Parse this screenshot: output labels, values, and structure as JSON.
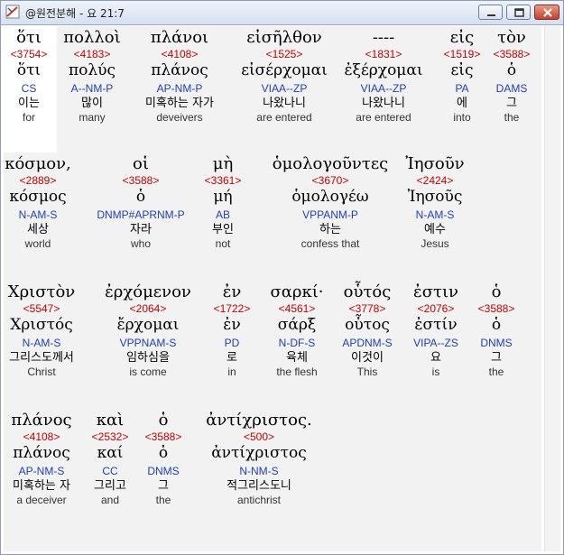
{
  "window": {
    "title": "@원전분해 - 요 21:7",
    "icon": "app-logo-icon"
  },
  "rows": [
    [
      {
        "greek": "ὅτι",
        "strong": "<3754>",
        "lemma": "ὅτι",
        "parse": "CS",
        "korean": "이는",
        "english": "for"
      },
      {
        "greek": "πολλοὶ",
        "strong": "<4183>",
        "lemma": "πολύς",
        "parse": "A--NM-P",
        "korean": "많이",
        "english": "many"
      },
      {
        "greek": "πλάνοι",
        "strong": "<4108>",
        "lemma": "πλάνος",
        "parse": "AP-NM-P",
        "korean": "미혹하는 자가",
        "english": "deveivers"
      },
      {
        "greek": "εἰσῆλθον",
        "strong": "<1525>",
        "lemma": "εἰσέρχομαι",
        "parse": "VIAA--ZP",
        "korean": "나왔나니",
        "english": "are entered"
      },
      {
        "greek": "----",
        "strong": "<1831>",
        "lemma": "ἐξέρχομαι",
        "parse": "VIAA--ZP",
        "korean": "나왔나니",
        "english": "are entered"
      },
      {
        "greek": "εἰς",
        "strong": "<1519>",
        "lemma": "εἰς",
        "parse": "PA",
        "korean": "에",
        "english": "into"
      },
      {
        "greek": "τὸν",
        "strong": "<3588>",
        "lemma": "ὁ",
        "parse": "DAMS",
        "korean": "그",
        "english": "the"
      }
    ],
    [
      {
        "greek": "κόσμον,",
        "strong": "<2889>",
        "lemma": "κόσμος",
        "parse": "N-AM-S",
        "korean": "세상",
        "english": "world"
      },
      {
        "greek": "οἱ",
        "strong": "<3588>",
        "lemma": "ὁ",
        "parse": "DNMP#APRNM-P",
        "korean": "자라",
        "english": "who"
      },
      {
        "greek": "μὴ",
        "strong": "<3361>",
        "lemma": "μή",
        "parse": "AB",
        "korean": "부인",
        "english": "not"
      },
      {
        "greek": "ὁμολογοῦντες",
        "strong": "<3670>",
        "lemma": "ὁμολογέω",
        "parse": "VPPANM-P",
        "korean": "하는",
        "english": "confess that"
      },
      {
        "greek": "Ἰησοῦν",
        "strong": "<2424>",
        "lemma": "Ἰησοῦς",
        "parse": "N-AM-S",
        "korean": "예수",
        "english": "Jesus"
      }
    ],
    [
      {
        "greek": "Χριστὸν",
        "strong": "<5547>",
        "lemma": "Χριστός",
        "parse": "N-AM-S",
        "korean": "그리스도께서",
        "english": "Christ"
      },
      {
        "greek": "ἐρχόμενον",
        "strong": "<2064>",
        "lemma": "ἔρχομαι",
        "parse": "VPPNAM-S",
        "korean": "임하심을",
        "english": "is come"
      },
      {
        "greek": "ἐν",
        "strong": "<1722>",
        "lemma": "ἐν",
        "parse": "PD",
        "korean": "로",
        "english": "in"
      },
      {
        "greek": "σαρκί·",
        "strong": "<4561>",
        "lemma": "σάρξ",
        "parse": "N-DF-S",
        "korean": "육체",
        "english": "the flesh"
      },
      {
        "greek": "οὗτός",
        "strong": "<3778>",
        "lemma": "οὗτος",
        "parse": "APDNM-S",
        "korean": "이것이",
        "english": "This"
      },
      {
        "greek": "ἐστιν",
        "strong": "<2076>",
        "lemma": "ἐστίν",
        "parse": "VIPA--ZS",
        "korean": "요",
        "english": "is"
      },
      {
        "greek": "ὁ",
        "strong": "<3588>",
        "lemma": "ὁ",
        "parse": "DNMS",
        "korean": "그",
        "english": "the"
      }
    ],
    [
      {
        "greek": "πλάνος",
        "strong": "<4108>",
        "lemma": "πλάνος",
        "parse": "AP-NM-S",
        "korean": "미혹하는 자",
        "english": "a deceiver"
      },
      {
        "greek": "καὶ",
        "strong": "<2532>",
        "lemma": "καί",
        "parse": "CC",
        "korean": "그리고",
        "english": "and"
      },
      {
        "greek": "ὁ",
        "strong": "<3588>",
        "lemma": "ὁ",
        "parse": "DNMS",
        "korean": "그",
        "english": "the"
      },
      {
        "greek": "ἀντίχριστος.",
        "strong": "<500>",
        "lemma": "ἀντίχριστος",
        "parse": "N-NM-S",
        "korean": "적그리스도니",
        "english": "antichrist"
      }
    ]
  ]
}
